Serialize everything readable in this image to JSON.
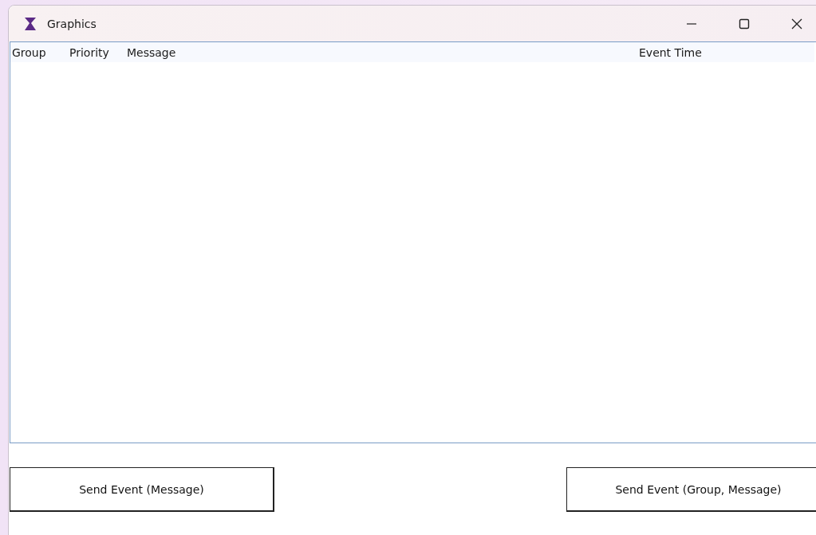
{
  "window": {
    "title": "Graphics"
  },
  "table": {
    "columns": [
      "Group",
      "Priority",
      "Message",
      "Event Time"
    ]
  },
  "buttons": [
    {
      "label": "Send Event (Message)"
    },
    {
      "label": "Send Event (Group, Message)"
    }
  ]
}
